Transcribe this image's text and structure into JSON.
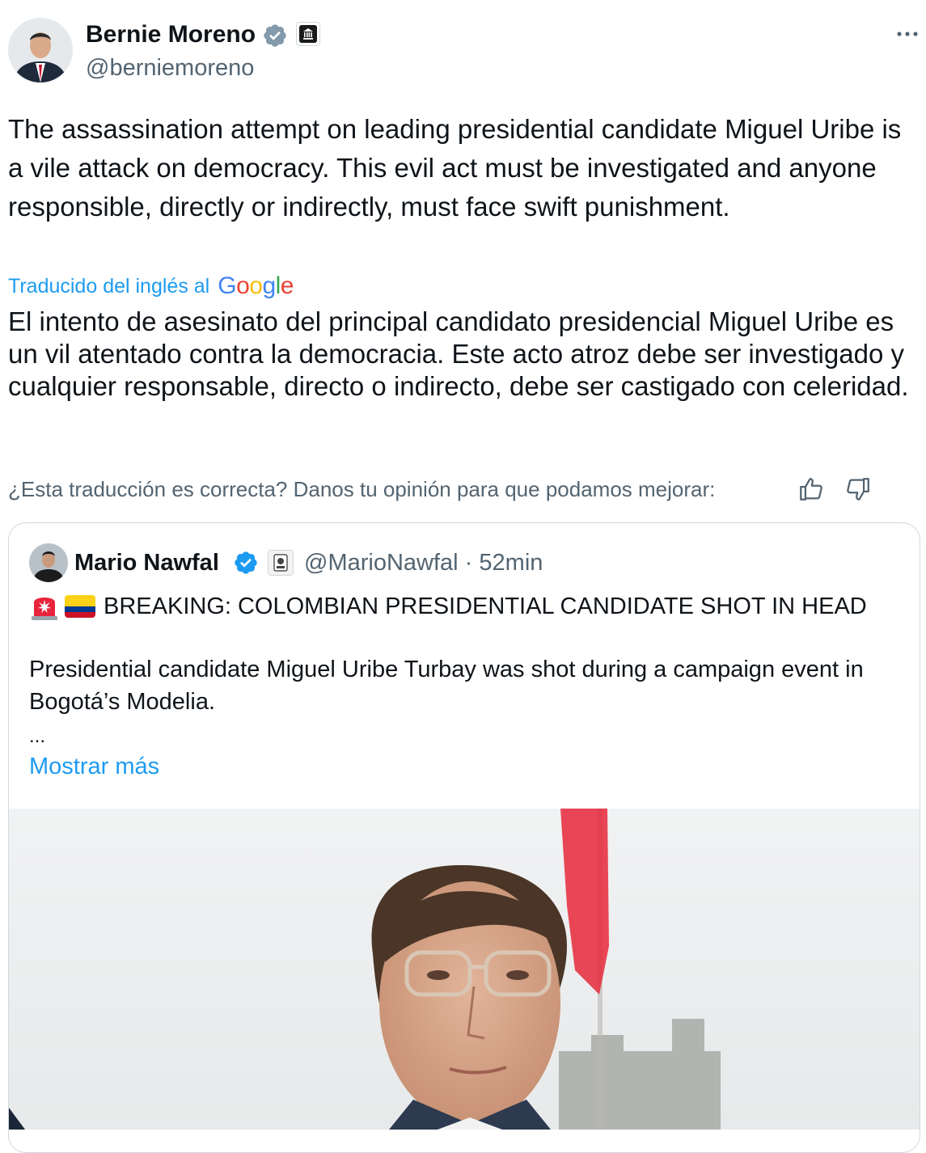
{
  "author": {
    "display_name": "Bernie Moreno",
    "handle": "@berniemoreno",
    "verified_badge_color": "#829aab",
    "badges": [
      "verified-gray-icon",
      "government-building-icon"
    ],
    "more_icon": "more-horizontal-icon"
  },
  "tweet": {
    "text": "The assassination attempt on leading presidential candidate Miguel Uribe is a vile attack on democracy. This evil act must be investigated and anyone responsible, directly or indirectly, must face swift punishment."
  },
  "translation": {
    "label": "Traducido del inglés al",
    "provider": [
      "G",
      "o",
      "o",
      "g",
      "l",
      "e"
    ],
    "text": "El intento de asesinato del principal candidato presidencial Miguel Uribe es un vil atentado contra la democracia. Este acto atroz debe ser investigado y cualquier responsable, directo o indirecto, debe ser castigado con celeridad.",
    "feedback_prompt": "¿Esta traducción es correcta? Danos tu opinión para que podamos mejorar:"
  },
  "quoted": {
    "display_name": "Mario Nawfal",
    "verified_badge_color": "#1d9bf0",
    "handle": "@MarioNawfal",
    "separator": "·",
    "time": "52min",
    "headline": "BREAKING: COLOMBIAN PRESIDENTIAL CANDIDATE SHOT IN HEAD",
    "emojis": [
      "siren-icon",
      "colombia-flag-icon"
    ],
    "body": "Presidential candidate Miguel Uribe Turbay was shot during a campaign event in Bogotá’s Modelia.",
    "ellipsis": "...",
    "show_more": "Mostrar más"
  },
  "colors": {
    "link": "#1d9bf0",
    "secondary_text": "#536471",
    "border": "#cfd9de"
  }
}
